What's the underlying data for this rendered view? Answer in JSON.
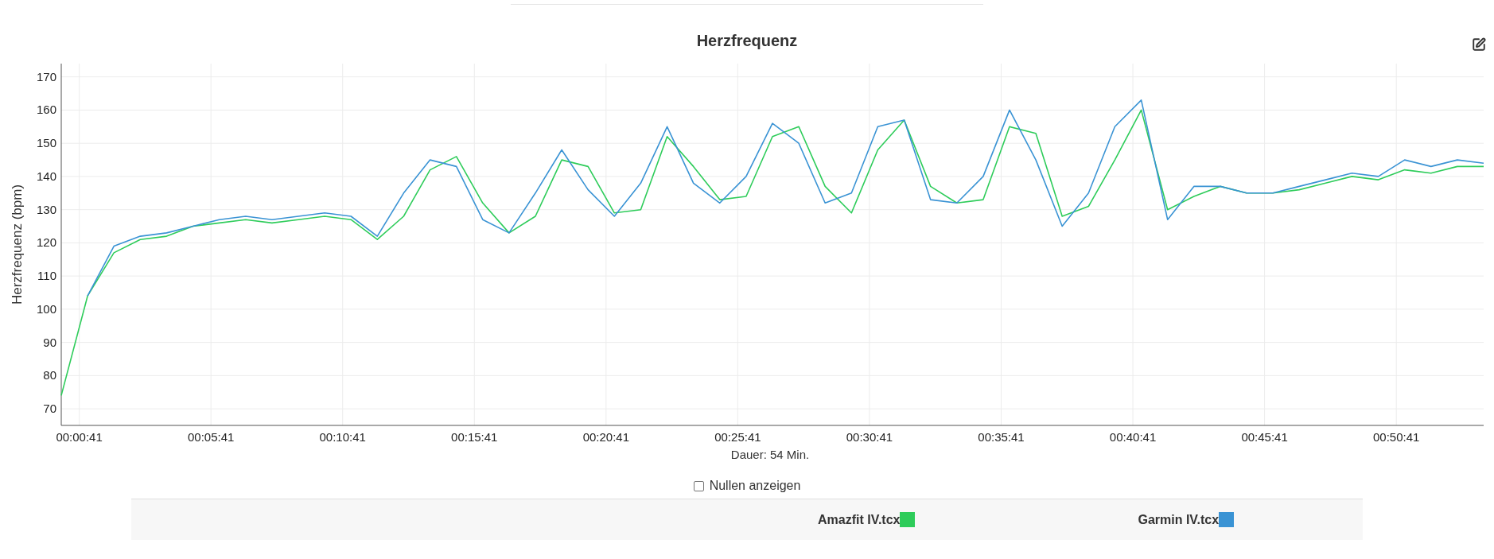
{
  "title": "Herzfrequenz",
  "chart": {
    "chart_data": {
      "type": "line",
      "grid": true,
      "ylabel": "Herzfrequenz (bpm)",
      "xlabel": "Dauer: 54 Min.",
      "xlim": [
        0,
        54
      ],
      "ylim": [
        65,
        174
      ],
      "x": [
        0,
        1,
        2,
        3,
        4,
        5,
        6,
        7,
        8,
        9,
        10,
        11,
        12,
        13,
        14,
        15,
        16,
        17,
        18,
        19,
        20,
        21,
        22,
        23,
        24,
        25,
        26,
        27,
        28,
        29,
        30,
        31,
        32,
        33,
        34,
        35,
        36,
        37,
        38,
        39,
        40,
        41,
        42,
        43,
        44,
        45,
        46,
        47,
        48,
        49,
        50,
        51,
        52,
        53,
        54
      ],
      "series": [
        {
          "name": "Amazfit IV.tcx",
          "color": "#2ecc5a",
          "values": [
            74,
            104,
            117,
            121,
            122,
            125,
            126,
            127,
            126,
            127,
            128,
            127,
            121,
            128,
            142,
            146,
            132,
            123,
            128,
            145,
            143,
            129,
            130,
            152,
            143,
            133,
            134,
            152,
            155,
            137,
            129,
            148,
            157,
            137,
            132,
            133,
            155,
            153,
            128,
            131,
            145,
            160,
            130,
            134,
            137,
            135,
            135,
            136,
            138,
            140,
            139,
            142,
            141,
            143,
            143
          ]
        },
        {
          "name": "Garmin IV.tcx",
          "color": "#3a93d4",
          "values": [
            null,
            104,
            119,
            122,
            123,
            125,
            127,
            128,
            127,
            128,
            129,
            128,
            122,
            135,
            145,
            143,
            127,
            123,
            135,
            148,
            136,
            128,
            138,
            155,
            138,
            132,
            140,
            156,
            150,
            132,
            135,
            155,
            157,
            133,
            132,
            140,
            160,
            145,
            125,
            135,
            155,
            163,
            127,
            137,
            137,
            135,
            135,
            137,
            139,
            141,
            140,
            145,
            143,
            145,
            144
          ]
        }
      ],
      "xticks": [
        {
          "value": 0.683,
          "label": "00:00:41"
        },
        {
          "value": 5.683,
          "label": "00:05:41"
        },
        {
          "value": 10.683,
          "label": "00:10:41"
        },
        {
          "value": 15.683,
          "label": "00:15:41"
        },
        {
          "value": 20.683,
          "label": "00:20:41"
        },
        {
          "value": 25.683,
          "label": "00:25:41"
        },
        {
          "value": 30.683,
          "label": "00:30:41"
        },
        {
          "value": 35.683,
          "label": "00:35:41"
        },
        {
          "value": 40.683,
          "label": "00:40:41"
        },
        {
          "value": 45.683,
          "label": "00:45:41"
        },
        {
          "value": 50.683,
          "label": "00:50:41"
        }
      ],
      "yticks": [
        70,
        80,
        90,
        100,
        110,
        120,
        130,
        140,
        150,
        160,
        170
      ]
    }
  },
  "zeros_checkbox": {
    "label": "Nullen anzeigen",
    "checked": false
  }
}
